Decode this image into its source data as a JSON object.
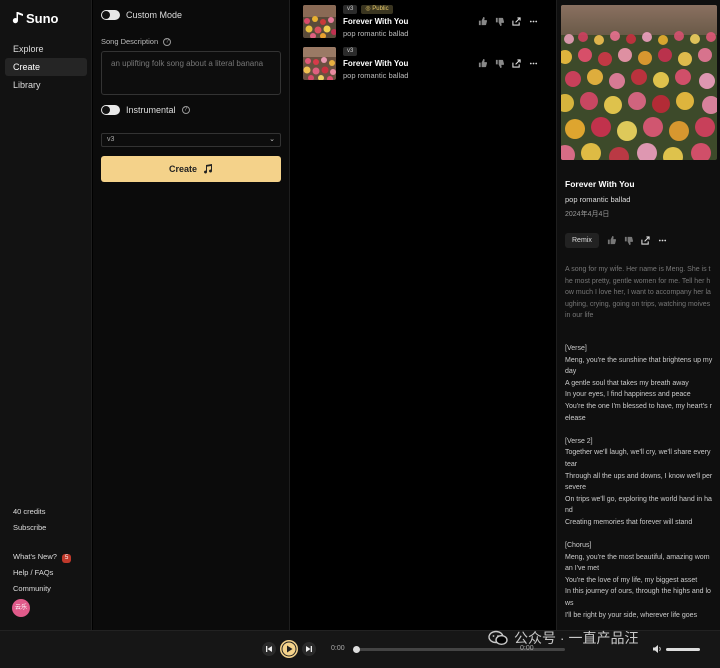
{
  "brand": {
    "name": "Suno"
  },
  "nav": {
    "items": [
      "Explore",
      "Create",
      "Library"
    ],
    "active": "Create"
  },
  "sidebar": {
    "credits": "40 credits",
    "subscribe": "Subscribe",
    "whats_new": "What's New?",
    "whats_new_badge": "5",
    "help": "Help / FAQs",
    "community": "Community",
    "avatar_text": "云乐"
  },
  "create": {
    "custom_mode_label": "Custom Mode",
    "custom_mode_on": false,
    "song_description_label": "Song Description",
    "song_description_value": "an uplifting folk song about a literal banana",
    "instrumental_label": "Instrumental",
    "instrumental_on": false,
    "model_select": "v3",
    "create_button": "Create"
  },
  "songs": [
    {
      "version": "v3",
      "visibility": "Public",
      "title": "Forever With You",
      "style": "pop romantic ballad"
    },
    {
      "version": "v3",
      "visibility": "",
      "title": "Forever With You",
      "style": "pop romantic ballad"
    }
  ],
  "detail": {
    "title": "Forever With You",
    "style": "pop romantic ballad",
    "date": "2024年4月4日",
    "remix_button": "Remix",
    "prompt": "A song for my wife.  Her name is Meng. She is the most pretty, gentle women for me. Tell her how much I love her, I want to accompany her laughing, crying, going on trips, watching moives in our life",
    "lyrics": "[Verse]\nMeng, you're the sunshine that brightens up my day\nA gentle soul that takes my breath away\nIn your eyes, I find happiness and peace\nYou're the one I'm blessed to have, my heart's release\n\n[Verse 2]\nTogether we'll laugh, we'll cry, we'll share every tear\nThrough all the ups and downs, I know we'll persevere\nOn trips we'll go, exploring the world hand in hand\nCreating memories that forever will stand\n\n[Chorus]\nMeng, you're the most beautiful, amazing woman I've met\nYou're the love of my life, my biggest asset\nIn this journey of ours, through the highs and lows\nI'll be right by your side, wherever life goes"
  },
  "player": {
    "current_time": "0:00",
    "end_time": "0:00",
    "progress": 0
  },
  "watermark": {
    "text": "公众号 · 一直产品汪"
  },
  "colors": {
    "accent": "#f4d28a",
    "badge": "#c0392b"
  }
}
